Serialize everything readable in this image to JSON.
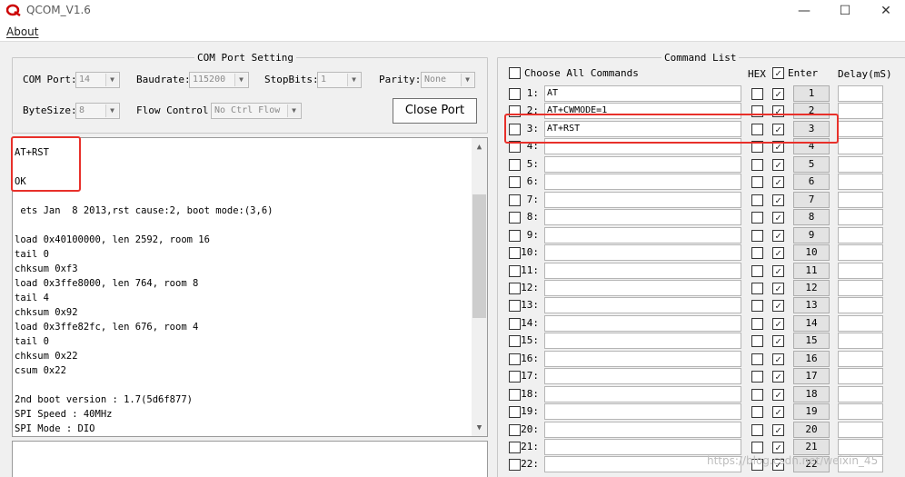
{
  "window": {
    "title": "QCOM_V1.6",
    "minimize": "—",
    "maximize": "☐",
    "close": "✕"
  },
  "menu": {
    "about": "About"
  },
  "com_port": {
    "legend": "COM Port Setting",
    "com_port_label": "COM Port:",
    "com_port_value": "14",
    "baudrate_label": "Baudrate:",
    "baudrate_value": "115200",
    "stopbits_label": "StopBits:",
    "stopbits_value": "1",
    "parity_label": "Parity:",
    "parity_value": "None",
    "bytesize_label": "ByteSize:",
    "bytesize_value": "8",
    "flow_label": "Flow Control:",
    "flow_value": "No Ctrl Flow",
    "close_port": "Close Port"
  },
  "log": {
    "lines": [
      "AT+RST",
      "",
      "OK",
      "",
      " ets Jan  8 2013,rst cause:2, boot mode:(3,6)",
      "",
      "load 0x40100000, len 2592, room 16",
      "tail 0",
      "chksum 0xf3",
      "load 0x3ffe8000, len 764, room 8",
      "tail 4",
      "chksum 0x92",
      "load 0x3ffe82fc, len 676, room 4",
      "tail 0",
      "chksum 0x22",
      "csum 0x22",
      "",
      "2nd boot version : 1.7(5d6f877)",
      "SPI Speed : 40MHz",
      "SPI Mode : DIO"
    ]
  },
  "command_list": {
    "legend": "Command List",
    "choose_all": "Choose All Commands",
    "hex_header": "HEX",
    "enter_header": "Enter",
    "delay_header": "Delay(mS)",
    "rows": [
      {
        "num": "1:",
        "cmd": "AT",
        "btn": "1"
      },
      {
        "num": "2:",
        "cmd": "AT+CWMODE=1",
        "btn": "2"
      },
      {
        "num": "3:",
        "cmd": "AT+RST",
        "btn": "3"
      },
      {
        "num": "4:",
        "cmd": "",
        "btn": "4"
      },
      {
        "num": "5:",
        "cmd": "",
        "btn": "5"
      },
      {
        "num": "6:",
        "cmd": "",
        "btn": "6"
      },
      {
        "num": "7:",
        "cmd": "",
        "btn": "7"
      },
      {
        "num": "8:",
        "cmd": "",
        "btn": "8"
      },
      {
        "num": "9:",
        "cmd": "",
        "btn": "9"
      },
      {
        "num": "10:",
        "cmd": "",
        "btn": "10"
      },
      {
        "num": "11:",
        "cmd": "",
        "btn": "11"
      },
      {
        "num": "12:",
        "cmd": "",
        "btn": "12"
      },
      {
        "num": "13:",
        "cmd": "",
        "btn": "13"
      },
      {
        "num": "14:",
        "cmd": "",
        "btn": "14"
      },
      {
        "num": "15:",
        "cmd": "",
        "btn": "15"
      },
      {
        "num": "16:",
        "cmd": "",
        "btn": "16"
      },
      {
        "num": "17:",
        "cmd": "",
        "btn": "17"
      },
      {
        "num": "18:",
        "cmd": "",
        "btn": "18"
      },
      {
        "num": "19:",
        "cmd": "",
        "btn": "19"
      },
      {
        "num": "20:",
        "cmd": "",
        "btn": "20"
      },
      {
        "num": "21:",
        "cmd": "",
        "btn": "21"
      },
      {
        "num": "22:",
        "cmd": "",
        "btn": "22"
      }
    ]
  },
  "watermark": "https://blog.csdn.net/weixin_45",
  "colors": {
    "highlight": "#e8302a",
    "title_gray": "#5a5a5a"
  }
}
